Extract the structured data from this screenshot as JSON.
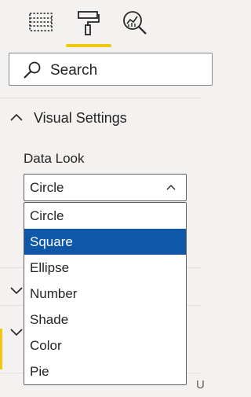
{
  "tabs": [
    {
      "name": "fields",
      "icon": "table-grid-icon"
    },
    {
      "name": "format",
      "icon": "paint-roller-icon",
      "active": true
    },
    {
      "name": "analytics",
      "icon": "analytics-magnifier-icon"
    }
  ],
  "search": {
    "placeholder": "Search",
    "icon": "search-icon"
  },
  "section": {
    "title": "Visual Settings",
    "expanded": true
  },
  "field": {
    "label": "Data Look",
    "selected": "Circle",
    "options": [
      "Circle",
      "Square",
      "Ellipse",
      "Number",
      "Shade",
      "Color",
      "Pie"
    ],
    "highlighted": "Square"
  },
  "colors": {
    "accent": "#f2c80f",
    "highlight": "#0f57a8",
    "background": "#f3f2f1"
  },
  "partial_text": "U"
}
